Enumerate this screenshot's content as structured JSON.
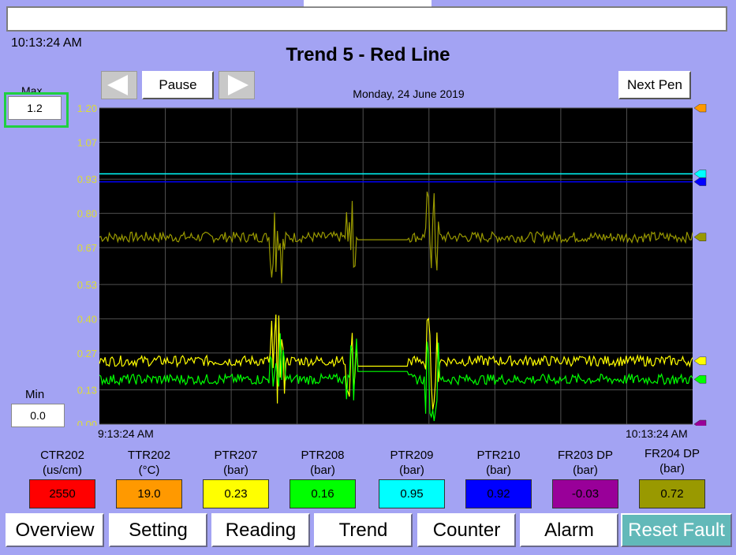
{
  "clock": "10:13:24 AM",
  "title": "Trend 5 - Red Line",
  "date": "Monday, 24 June 2019",
  "controls": {
    "pause_label": "Pause",
    "next_pen_label": "Next Pen"
  },
  "scale": {
    "max_label": "Max",
    "max_value": "1.2",
    "min_label": "Min",
    "min_value": "0.0"
  },
  "time_axis": {
    "start": "9:13:24 AM",
    "end": "10:13:24 AM"
  },
  "tags": [
    {
      "name": "CTR202",
      "unit": "(us/cm)",
      "value": "2550",
      "color": "#ff0000"
    },
    {
      "name": "TTR202",
      "unit": "(°C)",
      "value": "19.0",
      "color": "#ff9900"
    },
    {
      "name": "PTR207",
      "unit": "(bar)",
      "value": "0.23",
      "color": "#ffff00"
    },
    {
      "name": "PTR208",
      "unit": "(bar)",
      "value": "0.16",
      "color": "#00ff00"
    },
    {
      "name": "PTR209",
      "unit": "(bar)",
      "value": "0.95",
      "color": "#00ffff"
    },
    {
      "name": "PTR210",
      "unit": "(bar)",
      "value": "0.92",
      "color": "#0000ff"
    },
    {
      "name": "FR203 DP",
      "unit": "(bar)",
      "value": "-0.03",
      "color": "#990099"
    },
    {
      "name": "FR204 DP",
      "unit": "(bar)",
      "value": "0.72",
      "color": "#999900"
    }
  ],
  "nav": [
    {
      "label": "Overview"
    },
    {
      "label": "Setting"
    },
    {
      "label": "Reading"
    },
    {
      "label": "Trend"
    },
    {
      "label": "Counter"
    },
    {
      "label": "Alarm"
    },
    {
      "label": "Reset Fault"
    }
  ],
  "chart_data": {
    "type": "line",
    "y_ticks": [
      "1.20",
      "1.07",
      "0.93",
      "0.80",
      "0.67",
      "0.53",
      "0.40",
      "0.27",
      "0.13",
      "0.00"
    ],
    "ylim": [
      0,
      1.2
    ],
    "x_range": [
      "9:13:24 AM",
      "10:13:24 AM"
    ],
    "grid": true,
    "series": [
      {
        "color": "#999900",
        "baseline": 0.71,
        "noise": 0.02,
        "dip_to": 0.7,
        "dip_range": [
          0.42,
          0.52
        ]
      },
      {
        "color": "#ffff00",
        "baseline": 0.24,
        "noise": 0.02,
        "dip_to": 0.22,
        "dip_range": [
          0.42,
          0.52
        ]
      },
      {
        "color": "#00ff00",
        "baseline": 0.17,
        "noise": 0.02,
        "dip_to": 0.2,
        "dip_range": [
          0.42,
          0.52
        ]
      },
      {
        "color": "#00ffff",
        "baseline": 0.95,
        "noise": 0.0
      },
      {
        "color": "#0000ff",
        "baseline": 0.92,
        "noise": 0.0
      }
    ],
    "markers": [
      {
        "value": 1.2,
        "color": "#ff9900"
      },
      {
        "value": 0.95,
        "color": "#00ffff"
      },
      {
        "value": 0.92,
        "color": "#0000ff"
      },
      {
        "value": 0.71,
        "color": "#999900"
      },
      {
        "value": 0.24,
        "color": "#ffff00"
      },
      {
        "value": 0.17,
        "color": "#00ff00"
      },
      {
        "value": 0.0,
        "color": "#990099"
      }
    ]
  }
}
